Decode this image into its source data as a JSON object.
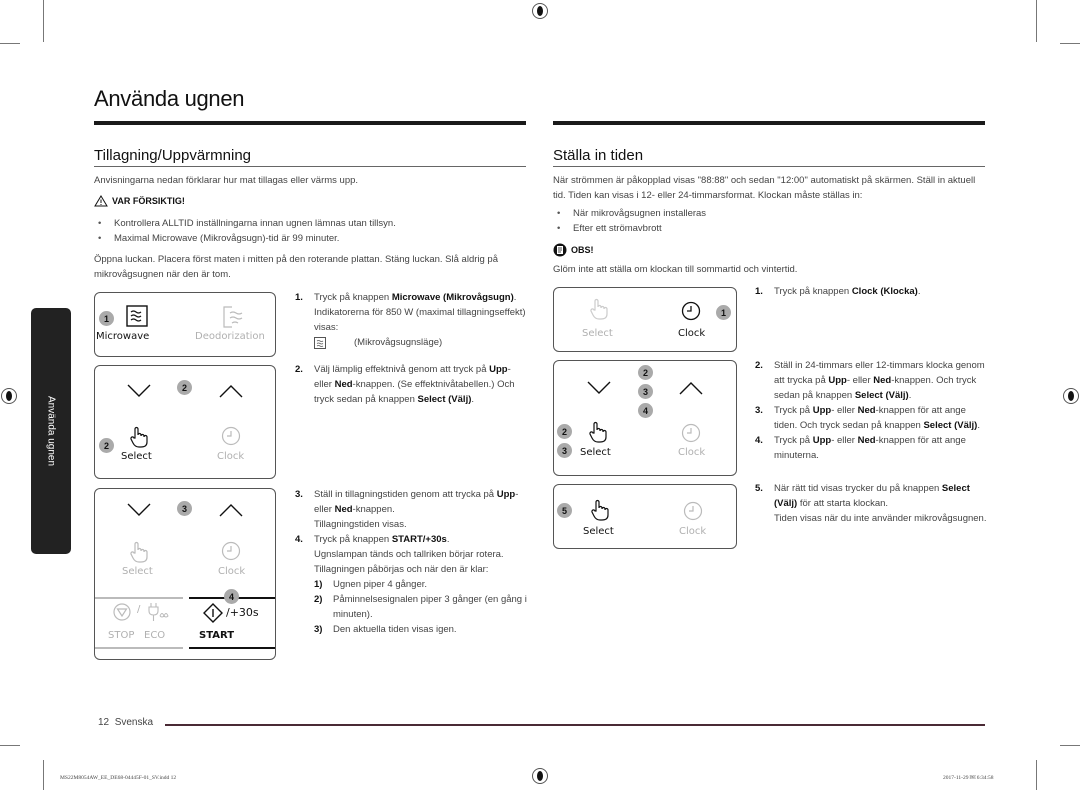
{
  "page": {
    "title": "Använda ugnen",
    "side_tab": "Använda ugnen",
    "footer": {
      "page_number": "12",
      "language": "Svenska"
    },
    "slug_left": "MS22M8054AW_EE_DE68-04445F-01_SV.indd   12",
    "slug_right": "2017-11-29   ￼ 6:34:58"
  },
  "left": {
    "heading": "Tillagning/Uppvärmning",
    "intro": "Anvisningarna nedan förklarar hur mat tillagas eller värms upp.",
    "caution_label": "VAR FÖRSIKTIG!",
    "caution_bullets": [
      "Kontrollera ALLTID inställningarna innan ugnen lämnas utan tillsyn.",
      "Maximal Microwave (Mikrovågsugn)-tid är 99 minuter."
    ],
    "paragraph": "Öppna luckan. Placera först maten i mitten på den roterande plattan. Stäng luckan. Slå aldrig på mikrovågsugnen när den är tom.",
    "panels": {
      "p1": {
        "badge": "1",
        "microwave": "Microwave",
        "deodorization": "Deodorization"
      },
      "p2": {
        "badge_arrows": "2",
        "badge_select": "2",
        "select": "Select",
        "clock": "Clock"
      },
      "p3": {
        "badge_arrows": "3",
        "badge_start": "4",
        "select": "Select",
        "clock": "Clock",
        "stop": "STOP",
        "eco": "ECO",
        "slash": "/",
        "plus30": "/+30s",
        "start": "START"
      }
    },
    "steps": [
      {
        "n": "1.",
        "parts": [
          [
            "t",
            "Tryck på knappen "
          ],
          [
            "b",
            "Microwave (Mikrovågsugn)"
          ],
          [
            "t",
            ". Indikatorerna för 850 W (maximal tillagningseffekt) visas:"
          ]
        ],
        "mode_text": "(Mikrovågsugnsläge)"
      },
      {
        "n": "2.",
        "parts": [
          [
            "t",
            "Välj lämplig effektnivå genom att tryck på "
          ],
          [
            "b",
            "Upp"
          ],
          [
            "t",
            "- eller "
          ],
          [
            "b",
            "Ned"
          ],
          [
            "t",
            "-knappen. (Se effektnivåtabellen.) Och tryck sedan på knappen "
          ],
          [
            "b",
            "Select (Välj)"
          ],
          [
            "t",
            "."
          ]
        ]
      },
      {
        "n": "3.",
        "parts": [
          [
            "t",
            "Ställ in tillagningstiden genom att trycka på "
          ],
          [
            "b",
            "Upp"
          ],
          [
            "t",
            "- eller "
          ],
          [
            "b",
            "Ned"
          ],
          [
            "t",
            "-knappen."
          ]
        ],
        "extra": "Tillagningstiden visas."
      },
      {
        "n": "4.",
        "parts": [
          [
            "t",
            "Tryck på knappen "
          ],
          [
            "b",
            "START/+30s"
          ],
          [
            "t",
            "."
          ]
        ],
        "extra": "Ugnslampan tänds och tallriken börjar rotera. Tillagningen påbörjas och när den är klar:",
        "subs": [
          {
            "n": "1)",
            "t": "Ugnen piper 4 gånger."
          },
          {
            "n": "2)",
            "t": "Påminnelsesignalen piper 3 gånger (en gång i minuten)."
          },
          {
            "n": "3)",
            "t": "Den aktuella tiden visas igen."
          }
        ]
      }
    ]
  },
  "right": {
    "heading": "Ställa in tiden",
    "intro": "När strömmen är påkopplad visas \"88:88\" och sedan \"12:00\" automatiskt på skärmen. Ställ in aktuell tid. Tiden kan visas i 12- eller 24-timmarsformat. Klockan måste ställas in:",
    "bullets": [
      "När mikrovågsugnen installeras",
      "Efter ett strömavbrott"
    ],
    "note_label": "OBS!",
    "note_text": "Glöm inte att ställa om klockan till sommartid och vintertid.",
    "panels": {
      "p1": {
        "badge": "1",
        "select": "Select",
        "clock": "Clock"
      },
      "p2": {
        "badges_mid": [
          "2",
          "3",
          "4"
        ],
        "badges_left": [
          "2",
          "3"
        ],
        "select": "Select",
        "clock": "Clock"
      },
      "p3": {
        "badge": "5",
        "select": "Select",
        "clock": "Clock"
      }
    },
    "steps": [
      {
        "n": "1.",
        "parts": [
          [
            "t",
            "Tryck på knappen "
          ],
          [
            "b",
            "Clock (Klocka)"
          ],
          [
            "t",
            "."
          ]
        ]
      },
      {
        "n": "2.",
        "parts": [
          [
            "t",
            "Ställ in 24-timmars eller 12-timmars klocka genom att trycka på "
          ],
          [
            "b",
            "Upp"
          ],
          [
            "t",
            "- eller "
          ],
          [
            "b",
            "Ned"
          ],
          [
            "t",
            "-knappen. Och tryck sedan på knappen "
          ],
          [
            "b",
            "Select (Välj)"
          ],
          [
            "t",
            "."
          ]
        ]
      },
      {
        "n": "3.",
        "parts": [
          [
            "t",
            "Tryck på "
          ],
          [
            "b",
            "Upp"
          ],
          [
            "t",
            "- eller "
          ],
          [
            "b",
            "Ned"
          ],
          [
            "t",
            "-knappen för att ange tiden. Och tryck sedan på knappen "
          ],
          [
            "b",
            "Select (Välj)"
          ],
          [
            "t",
            "."
          ]
        ]
      },
      {
        "n": "4.",
        "parts": [
          [
            "t",
            "Tryck på "
          ],
          [
            "b",
            "Upp"
          ],
          [
            "t",
            "- eller "
          ],
          [
            "b",
            "Ned"
          ],
          [
            "t",
            "-knappen för att ange minuterna."
          ]
        ]
      },
      {
        "n": "5.",
        "parts": [
          [
            "t",
            "När rätt tid visas trycker du på knappen "
          ],
          [
            "b",
            "Select (Välj)"
          ],
          [
            "t",
            " för att starta klockan."
          ]
        ],
        "extra": "Tiden visas när du inte använder mikrovågsugnen."
      }
    ]
  }
}
